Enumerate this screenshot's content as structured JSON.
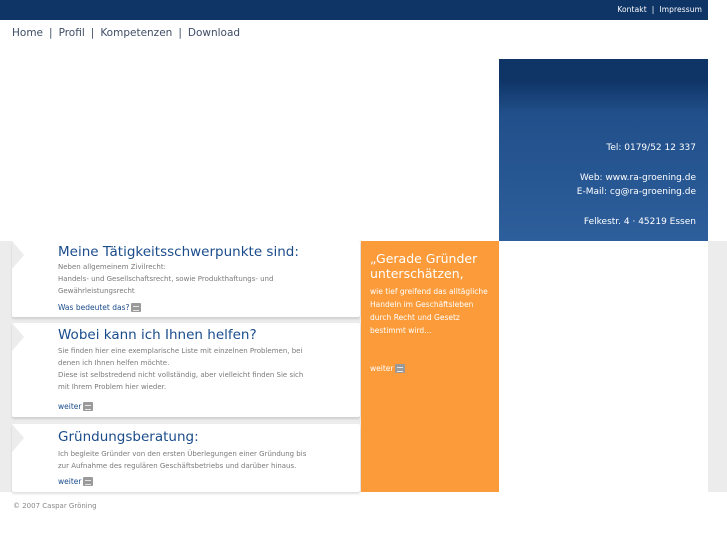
{
  "top_links": {
    "kontakt": "Kontakt",
    "separator": "|",
    "impressum": "Impressum"
  },
  "nav": {
    "items": [
      "Home",
      "Profil",
      "Kompetenzen",
      "Download"
    ],
    "separator": "|"
  },
  "contact": {
    "tel": "Tel: 0179/52 12 337",
    "web": "Web: www.ra-groening.de",
    "email": "E-Mail: cg@ra-groening.de",
    "address": "Felkestr. 4 · 45219 Essen"
  },
  "sections": [
    {
      "title": "Meine Tätigkeitsschwerpunkte sind:",
      "lines": [
        "Neben allgemeinem Zivilrecht:",
        "Handels- und Gesellschaftsrecht, sowie Produkthaftungs- und",
        "Gewährleistungsrecht"
      ],
      "link": "Was bedeutet das?"
    },
    {
      "title": "Wobei kann ich Ihnen helfen?",
      "lines": [
        "Sie finden hier eine exemplarische Liste mit einzelnen Problemen, bei",
        "denen ich Ihnen helfen möchte.",
        "Diese ist selbstredend nicht vollständig, aber vielleicht finden Sie sich",
        "mit Ihrem Problem hier wieder."
      ],
      "link": "weiter"
    },
    {
      "title": "Gründungsberatung:",
      "lines": [
        "Ich begleite Gründer von den ersten Überlegungen einer Gründung bis",
        "zur Aufnahme des regulären Geschäftsbetriebs und darüber hinaus."
      ],
      "link": "weiter"
    }
  ],
  "quote": {
    "headline": "„Gerade Gründer unterschätzen,",
    "text": "wie tief greifend das alltägliche Handeln im Geschäftsleben durch Recht und Gesetz bestimmt wird...",
    "link": "weiter"
  },
  "footer": "© 2007 Caspar Gröning",
  "colors": {
    "navy": "#0f3567",
    "orange": "#fb9b3a",
    "title_blue": "#1a4c8c",
    "band_gray": "#ececec"
  },
  "icons": {
    "more_button": "more-arrow-icon"
  }
}
